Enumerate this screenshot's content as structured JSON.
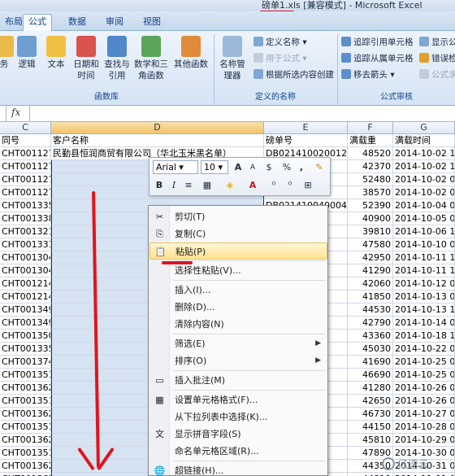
{
  "window": {
    "title": "磅单1.xls  [兼容模式] - Microsoft Excel"
  },
  "tabs": [
    "布局",
    "公式",
    "数据",
    "审阅",
    "视图"
  ],
  "ribbon": {
    "library_buttons": [
      {
        "label": "务",
        "icon": "function-icon"
      },
      {
        "label": "逻辑",
        "icon": "logic-icon"
      },
      {
        "label": "文本",
        "icon": "text-icon"
      },
      {
        "label": "日期和时间",
        "icon": "datetime-icon"
      },
      {
        "label": "查找与引用",
        "icon": "lookup-icon"
      },
      {
        "label": "数学和三角函数",
        "icon": "math-icon"
      },
      {
        "label": "其他函数",
        "icon": "more-functions-icon"
      }
    ],
    "library_label": "函数库",
    "names_label": "定义的名称",
    "name_manager": "名称管理器",
    "define_name": "定义名称",
    "use_in_formula": "用于公式",
    "create_from_selection": "根据所选内容创建",
    "audit_label": "公式审核",
    "trace_precedents": "追踪引用单元格",
    "trace_dependents": "追踪从属单元格",
    "remove_arrows": "移去箭头",
    "show_formulas": "显示公",
    "error_check": "错误检",
    "evaluate_formula": "公式求"
  },
  "formula_bar": {
    "fx": "fx",
    "value": ""
  },
  "columns": [
    {
      "letter": "C",
      "header": "同号"
    },
    {
      "letter": "D",
      "header": "客户名称"
    },
    {
      "letter": "E",
      "header": "磅单号"
    },
    {
      "letter": "F",
      "header": "满载重"
    },
    {
      "letter": "G",
      "header": "满载时间"
    }
  ],
  "rows": [
    {
      "c": "CHT001127",
      "d": "民勤县恒润商贸有限公司（华北玉米黑名单）",
      "e": "DB021410020012",
      "f": "48520",
      "g": "2014-10-02 13:"
    },
    {
      "c": "CHT001127",
      "d": "",
      "e": "11",
      "f": "42370",
      "g": "2014-10-02 13:"
    },
    {
      "c": "CHT001127",
      "d": "",
      "e": "11",
      "f": "52480",
      "g": "2014-10-02 09:"
    },
    {
      "c": "CHT001127",
      "d": "",
      "e": "08",
      "f": "38570",
      "g": "2014-10-02 09:"
    },
    {
      "c": "CHT001335",
      "d": "",
      "e": "DB021410040004",
      "f": "52390",
      "g": "2014-10-04 08:"
    },
    {
      "c": "CHT001338",
      "d": "",
      "e": "03",
      "f": "40900",
      "g": "2014-10-05 08:"
    },
    {
      "c": "CHT001321",
      "d": "",
      "e": "11",
      "f": "39810",
      "g": "2014-10-06 11:"
    },
    {
      "c": "CHT001331",
      "d": "",
      "e": "06",
      "f": "47580",
      "g": "2014-10-10 08:"
    },
    {
      "c": "CHT001304",
      "d": "",
      "e": "04",
      "f": "42950",
      "g": "2014-10-11 12:"
    },
    {
      "c": "CHT001304",
      "d": "",
      "e": "06",
      "f": "41290",
      "g": "2014-10-11 10:"
    },
    {
      "c": "CHT001214",
      "d": "",
      "e": "01",
      "f": "42060",
      "g": "2014-10-12 08:"
    },
    {
      "c": "CHT001214",
      "d": "",
      "e": "05",
      "f": "41850",
      "g": "2014-10-13 09:"
    },
    {
      "c": "CHT001349",
      "d": "",
      "e": "08",
      "f": "44530",
      "g": "2014-10-13 14:"
    },
    {
      "c": "CHT001349",
      "d": "",
      "e": "14",
      "f": "42790",
      "g": "2014-10-14 09:"
    },
    {
      "c": "CHT001350",
      "d": "",
      "e": "14",
      "f": "43360",
      "g": "2014-10-18 12:"
    },
    {
      "c": "CHT001335",
      "d": "",
      "e": "02",
      "f": "45030",
      "g": "2014-10-22 07:"
    },
    {
      "c": "CHT001374",
      "d": "",
      "e": "04",
      "f": "41690",
      "g": "2014-10-25 08:"
    },
    {
      "c": "CHT001351",
      "d": "",
      "e": "04",
      "f": "46690",
      "g": "2014-10-25 09:"
    },
    {
      "c": "CHT001362",
      "d": "",
      "e": "02",
      "f": "41280",
      "g": "2014-10-26 08:"
    },
    {
      "c": "CHT001351",
      "d": "",
      "e": "02",
      "f": "42650",
      "g": "2014-10-26 09:"
    },
    {
      "c": "CHT001362",
      "d": "",
      "e": "02",
      "f": "46730",
      "g": "2014-10-27 08:"
    },
    {
      "c": "CHT001351",
      "d": "",
      "e": "11",
      "f": "44150",
      "g": "2014-10-28 09:"
    },
    {
      "c": "CHT001362",
      "d": "",
      "e": "06",
      "f": "45810",
      "g": "2014-10-29 08:"
    },
    {
      "c": "CHT001351",
      "d": "",
      "e": "10",
      "f": "47890",
      "g": "2014-10-30 09:"
    },
    {
      "c": "CHT001362",
      "d": "",
      "e": "01",
      "f": "44350",
      "g": "2014-10-31 08:"
    },
    {
      "c": "CHT001362",
      "d": "",
      "e": "01",
      "f": "44810",
      "g": "2014-11-01 09:"
    },
    {
      "c": "CHT001351",
      "d": "",
      "e": "06",
      "f": "",
      "g": ""
    }
  ],
  "mini_toolbar": {
    "font": "Arial",
    "size": "10",
    "grow": "A",
    "shrink": "A",
    "currency": "$",
    "percent": "%",
    "comma": ",",
    "bold": "B",
    "italic": "I"
  },
  "context_menu": {
    "items": [
      {
        "label": "剪切(T)",
        "icon": "scissors-icon",
        "glyph": "✂"
      },
      {
        "label": "复制(C)",
        "icon": "copy-icon",
        "glyph": "⎘"
      },
      {
        "label": "粘贴(P)",
        "icon": "paste-icon",
        "glyph": "📋",
        "highlighted": true
      },
      {
        "label": "选择性粘贴(V)...",
        "icon": "",
        "glyph": ""
      },
      {
        "label": "插入(I)...",
        "icon": "",
        "glyph": ""
      },
      {
        "label": "删除(D)...",
        "icon": "",
        "glyph": ""
      },
      {
        "label": "清除内容(N)",
        "icon": "",
        "glyph": ""
      },
      {
        "label": "筛选(E)",
        "icon": "",
        "glyph": "",
        "submenu": true
      },
      {
        "label": "排序(O)",
        "icon": "",
        "glyph": "",
        "submenu": true
      },
      {
        "label": "插入批注(M)",
        "icon": "comment-icon",
        "glyph": "▭"
      },
      {
        "label": "设置单元格格式(F)...",
        "icon": "format-cells-icon",
        "glyph": "▦"
      },
      {
        "label": "从下拉列表中选择(K)...",
        "icon": "",
        "glyph": ""
      },
      {
        "label": "显示拼音字段(S)",
        "icon": "phonetic-icon",
        "glyph": "文"
      },
      {
        "label": "命名单元格区域(R)...",
        "icon": "",
        "glyph": ""
      },
      {
        "label": "超链接(H)...",
        "icon": "hyperlink-icon",
        "glyph": "🌐"
      }
    ]
  },
  "watermark": "亿速云",
  "colors": {
    "annotation": "#e1141c",
    "highlight": "#ffe394",
    "ribbon": "#d5e4f5"
  }
}
